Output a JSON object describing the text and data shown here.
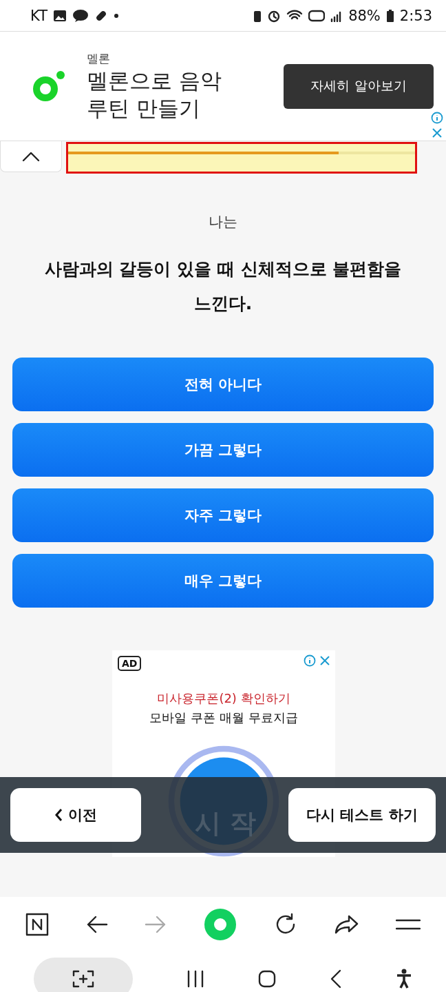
{
  "status_bar": {
    "carrier": "KT",
    "battery": "88%",
    "time": "2:53"
  },
  "top_ad": {
    "brand": "멜론",
    "headline": "멜론으로 음악\n루틴 만들기",
    "cta": "자세히 알아보기"
  },
  "progress": {
    "level": 0.78
  },
  "question": {
    "prefix": "나는",
    "text": "사람과의 갈등이 있을 때 신체적으로 불편함을 느낀다."
  },
  "answers": [
    {
      "label": "전혀 아니다"
    },
    {
      "label": "가끔 그렇다"
    },
    {
      "label": "자주 그렇다"
    },
    {
      "label": "매우 그렇다"
    }
  ],
  "bottom_ad": {
    "badge": "AD",
    "title": "미사용쿠폰(2) 확인하기",
    "subtitle": "모바일 쿠폰 매월 무료지급",
    "button_text": "시 작"
  },
  "nav_buttons": {
    "prev": "이전",
    "retry": "다시 테스트 하기"
  },
  "browser_toolbar": {
    "forward_disabled": true
  }
}
